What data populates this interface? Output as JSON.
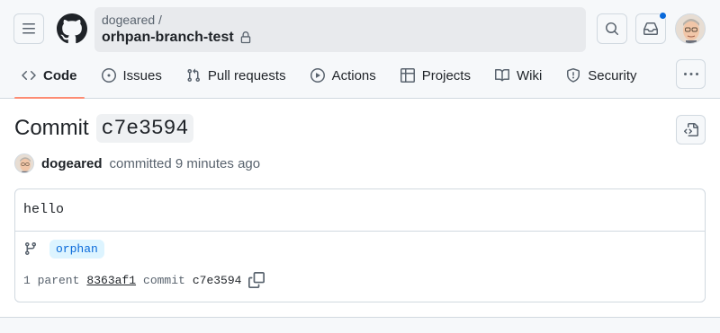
{
  "header": {
    "owner": "dogeared /",
    "repo": "orhpan-branch-test"
  },
  "tabs": [
    {
      "label": "Code",
      "icon": "code-icon",
      "selected": true
    },
    {
      "label": "Issues",
      "icon": "issue-opened-icon",
      "selected": false
    },
    {
      "label": "Pull requests",
      "icon": "git-pull-request-icon",
      "selected": false
    },
    {
      "label": "Actions",
      "icon": "play-icon",
      "selected": false
    },
    {
      "label": "Projects",
      "icon": "table-icon",
      "selected": false
    },
    {
      "label": "Wiki",
      "icon": "book-icon",
      "selected": false
    },
    {
      "label": "Security",
      "icon": "shield-icon",
      "selected": false
    }
  ],
  "commit": {
    "title_word": "Commit",
    "sha": "c7e3594",
    "author": "dogeared",
    "meta": "committed 9 minutes ago",
    "message": "hello",
    "branch": "orphan",
    "parent_label": "1 parent",
    "parent_sha": "8363af1",
    "commit_label": "commit",
    "commit_sha": "c7e3594"
  },
  "colors": {
    "accent_underline": "#fd8c73",
    "link_blue": "#0969da",
    "branch_bg": "#ddf4ff",
    "notification_dot": "#0969da"
  }
}
